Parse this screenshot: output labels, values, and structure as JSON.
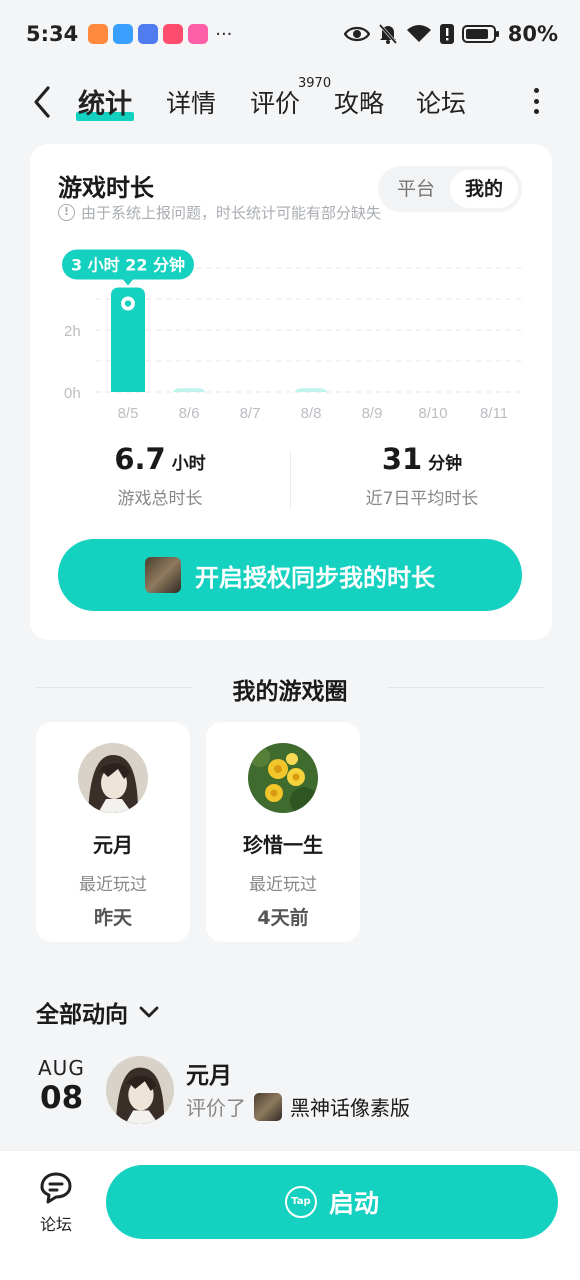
{
  "status_bar": {
    "time": "5:34",
    "more": "···",
    "battery": "80%",
    "app_icons": [
      "#ff8a3d",
      "#3aa0ff",
      "#4f7df0",
      "#ff4d6d",
      "#ff5fa8"
    ]
  },
  "tabs": [
    {
      "label": "统计",
      "active": true
    },
    {
      "label": "详情"
    },
    {
      "label": "评价",
      "count": "3970"
    },
    {
      "label": "攻略"
    },
    {
      "label": "论坛"
    }
  ],
  "stats": {
    "title": "游戏时长",
    "note": "由于系统上报问题，时长统计可能有部分缺失",
    "segments": [
      "平台",
      "我的"
    ],
    "active_segment": "我的",
    "total_value": "6.7",
    "total_unit": "小时",
    "total_label": "游戏总时长",
    "avg_value": "31",
    "avg_unit": "分钟",
    "avg_label": "近7日平均时长",
    "sync_label": "开启授权同步我的时长"
  },
  "chart_data": {
    "type": "bar",
    "categories": [
      "8/5",
      "8/6",
      "8/7",
      "8/8",
      "8/9",
      "8/10",
      "8/11"
    ],
    "values_hours": [
      3.37,
      0.12,
      0,
      0.12,
      0,
      0,
      0
    ],
    "ytick_labels": [
      "0h",
      "2h"
    ],
    "ylim": [
      0,
      4
    ],
    "highlight": {
      "index": 0,
      "label": "3 小时 22 分钟"
    },
    "grid": true,
    "bar_color": "#15d1c0"
  },
  "game_circle": {
    "title": "我的游戏圈",
    "friends": [
      {
        "name": "元月",
        "label": "最近玩过",
        "time": "昨天"
      },
      {
        "name": "珍惜一生",
        "label": "最近玩过",
        "time": "4天前"
      }
    ]
  },
  "activity": {
    "filter": "全部动向",
    "month": "AUG",
    "day": "08",
    "user": "元月",
    "verb": "评价了",
    "game": "黑神话像素版"
  },
  "bottom": {
    "forum_label": "论坛",
    "launch_label": "启动",
    "logo_text": "Tap"
  }
}
